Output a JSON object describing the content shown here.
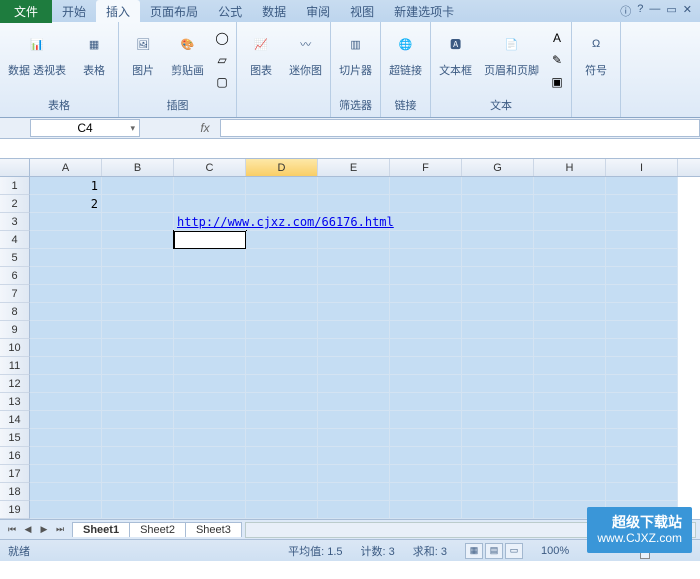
{
  "tabs": {
    "file": "文件",
    "items": [
      "开始",
      "插入",
      "页面布局",
      "公式",
      "数据",
      "审阅",
      "视图",
      "新建选项卡"
    ],
    "active_index": 1
  },
  "ribbon_groups": {
    "tables": {
      "label": "表格",
      "pivot": "数据\n透视表",
      "table": "表格"
    },
    "illustrations": {
      "label": "插图",
      "picture": "图片",
      "clipart": "剪贴画"
    },
    "charts": {
      "label": "",
      "chart": "图表",
      "sparkline": "迷你图"
    },
    "filter": {
      "label": "筛选器",
      "slicer": "切片器"
    },
    "links": {
      "label": "链接",
      "hyperlink": "超链接"
    },
    "text": {
      "label": "文本",
      "textbox": "文本框",
      "headerfooter": "页眉和页脚"
    },
    "symbols": {
      "label": "",
      "symbol": "符号"
    }
  },
  "namebox": "C4",
  "fx_label": "fx",
  "columns": [
    "A",
    "B",
    "C",
    "D",
    "E",
    "F",
    "G",
    "H",
    "I"
  ],
  "selected_col_index": 3,
  "row_count": 19,
  "active_cell": {
    "row": 4,
    "col": 2
  },
  "cells": {
    "A1": "1",
    "A2": "2",
    "C3": "http://www.cjxz.com/66176.html"
  },
  "sheets": [
    "Sheet1",
    "Sheet2",
    "Sheet3"
  ],
  "active_sheet": 0,
  "status": {
    "ready": "就绪",
    "avg": "平均值: 1.5",
    "count": "计数: 3",
    "sum": "求和: 3",
    "zoom": "100%"
  },
  "watermark": {
    "line1": "超级下载站",
    "line2": "www.CJXZ.com"
  }
}
